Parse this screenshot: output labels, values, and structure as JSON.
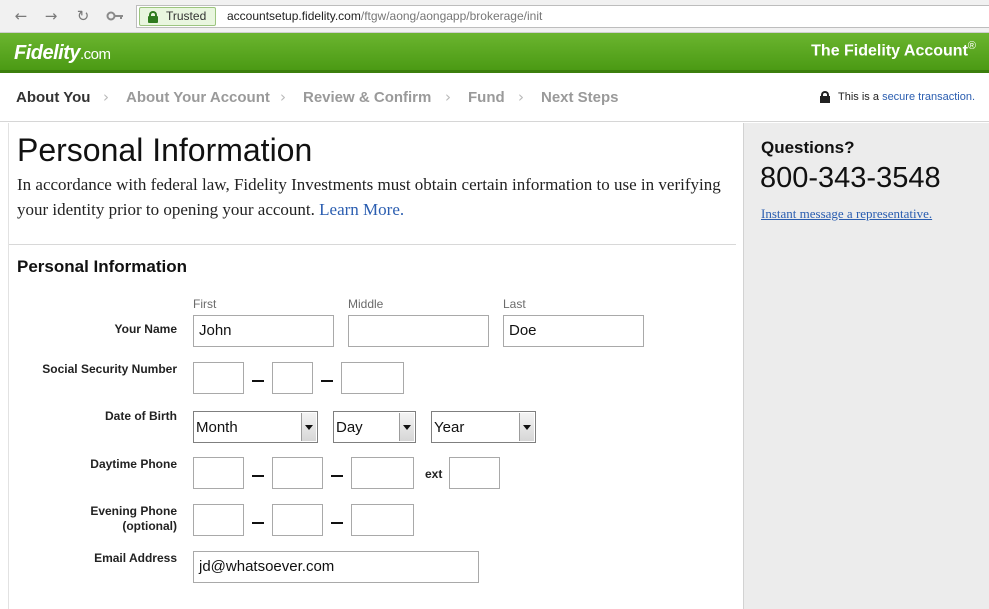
{
  "browser": {
    "trusted_label": "Trusted",
    "url_domain": "accountsetup.fidelity.com",
    "url_path": "/ftgw/aong/aongapp/brokerage/init",
    "icons": [
      "back-arrow-icon",
      "forward-arrow-icon",
      "reload-icon",
      "key-icon",
      "lock-icon"
    ]
  },
  "header": {
    "logo_text": "Fidelity",
    "logo_suffix": ".com",
    "account_title": "The Fidelity Account",
    "account_title_mark": "®",
    "brand_color": "#5aa81f"
  },
  "steps": {
    "items": [
      {
        "label": "About You",
        "active": true
      },
      {
        "label": "About Your Account",
        "active": false
      },
      {
        "label": "Review & Confirm",
        "active": false
      },
      {
        "label": "Fund",
        "active": false
      },
      {
        "label": "Next Steps",
        "active": false
      }
    ],
    "secure_prefix": "This is a",
    "secure_link": "secure transaction."
  },
  "main": {
    "page_title": "Personal Information",
    "intro_text": "In accordance with federal law, Fidelity Investments must obtain certain information to use in verifying your identity prior to opening your account.",
    "learn_more": "Learn More.",
    "section_title": "Personal Information",
    "name": {
      "label": "Your Name",
      "first_label": "First",
      "middle_label": "Middle",
      "last_label": "Last",
      "first_value": "John",
      "middle_value": "",
      "last_value": "Doe"
    },
    "ssn": {
      "label": "Social Security Number",
      "part1": "",
      "part2": "",
      "part3": ""
    },
    "dob": {
      "label": "Date of Birth",
      "month": "Month",
      "day": "Day",
      "year": "Year"
    },
    "daytime_phone": {
      "label": "Daytime Phone",
      "ext_label": "ext",
      "area": "",
      "prefix": "",
      "line": "",
      "ext": ""
    },
    "evening_phone": {
      "label_line1": "Evening Phone",
      "label_line2": "(optional)",
      "area": "",
      "prefix": "",
      "line": ""
    },
    "email": {
      "label": "Email Address",
      "value": "jd@whatsoever.com"
    }
  },
  "sidebar": {
    "title": "Questions?",
    "phone": "800-343-3548",
    "im_link": "Instant message a representative."
  }
}
